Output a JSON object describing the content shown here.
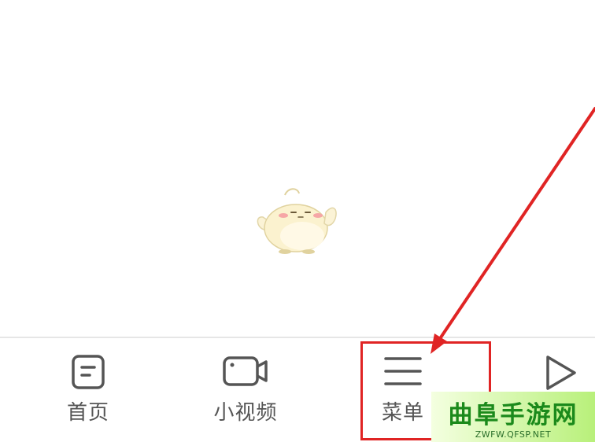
{
  "nav": {
    "items": [
      {
        "label": "首页",
        "icon": "home-document-icon"
      },
      {
        "label": "小视频",
        "icon": "video-camera-icon"
      },
      {
        "label": "菜单",
        "icon": "hamburger-menu-icon"
      },
      {
        "label": "",
        "icon": "play-icon"
      }
    ]
  },
  "annotation": {
    "color": "#e02424"
  },
  "watermark": {
    "title": "曲阜手游网",
    "url": "ZWFW.QFSP.NET"
  }
}
